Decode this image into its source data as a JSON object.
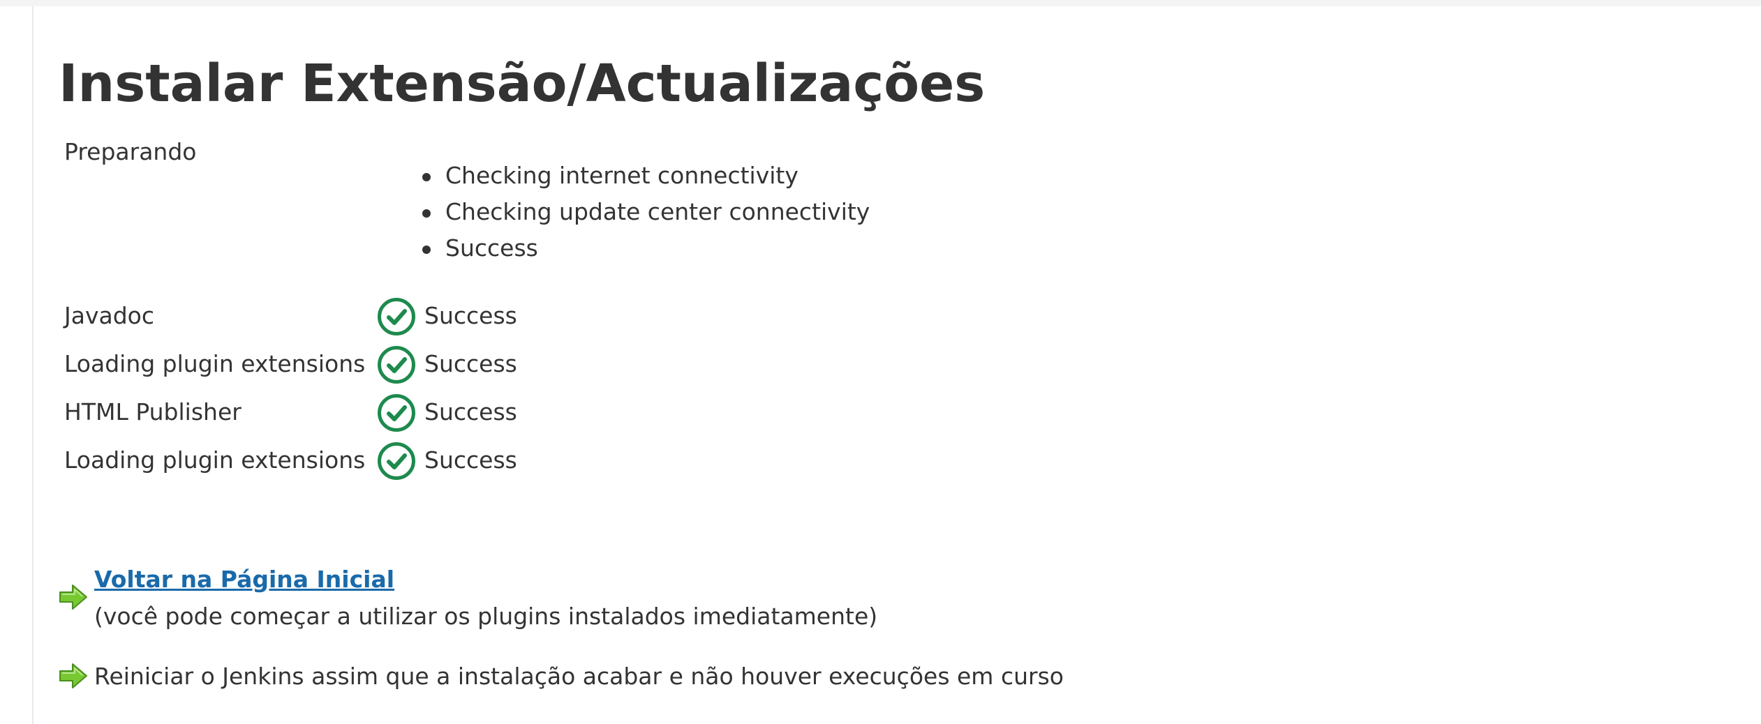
{
  "page": {
    "title": "Instalar Extensão/Actualizações"
  },
  "preparing": {
    "label": "Preparando",
    "steps": [
      "Checking internet connectivity",
      "Checking update center connectivity",
      "Success"
    ]
  },
  "jobs": [
    {
      "name": "Javadoc",
      "status": "Success",
      "status_icon": "success-check-icon"
    },
    {
      "name": "Loading plugin extensions",
      "status": "Success",
      "status_icon": "success-check-icon"
    },
    {
      "name": "HTML Publisher",
      "status": "Success",
      "status_icon": "success-check-icon"
    },
    {
      "name": "Loading plugin extensions",
      "status": "Success",
      "status_icon": "success-check-icon"
    }
  ],
  "actions": {
    "home_link": "Voltar na Página Inicial",
    "home_note": "(você pode começar a utilizar os plugins instalados imediatamente)",
    "restart_text": "Reiniciar o Jenkins assim que a instalação acabar e não houver execuções em curso",
    "arrow_icon": "arrow-right-icon"
  },
  "colors": {
    "success": "#1e8a4d",
    "link": "#1a6aaa",
    "arrow": "#6fbf2f",
    "text": "#333333"
  }
}
